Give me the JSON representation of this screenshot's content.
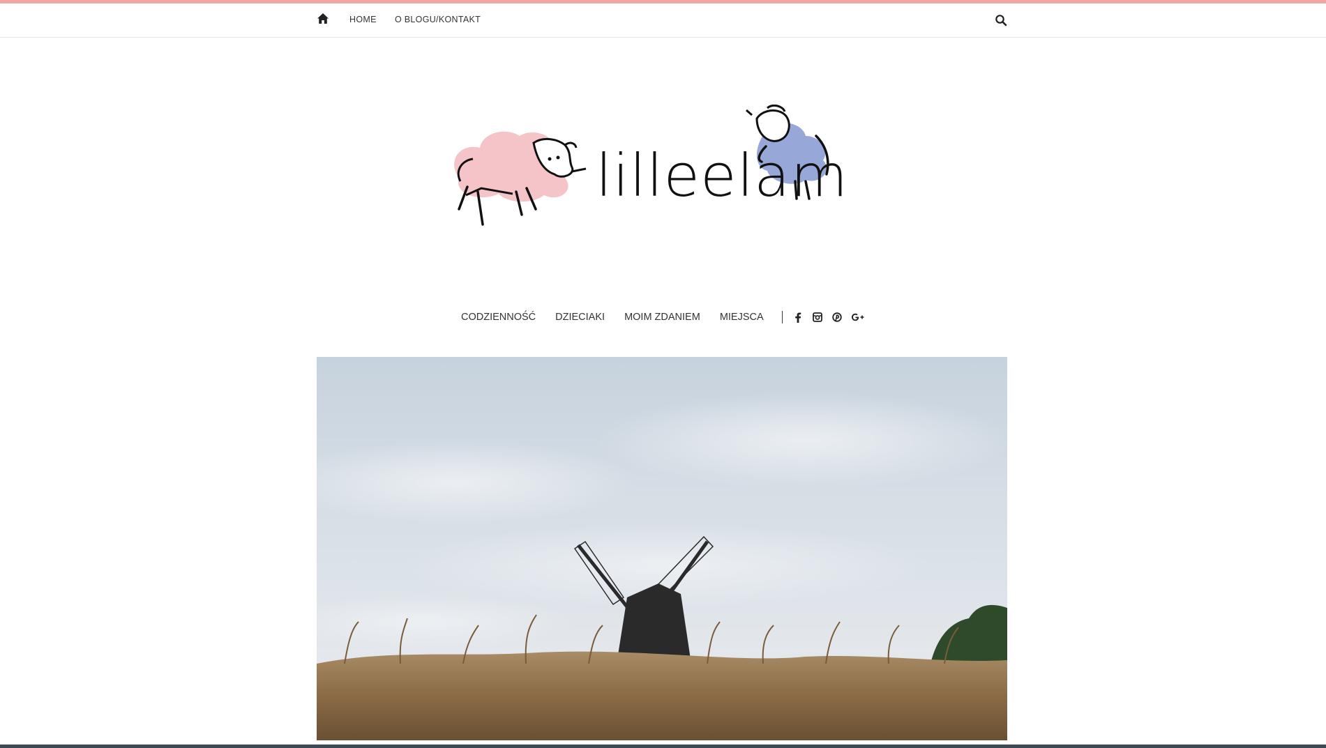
{
  "colors": {
    "accent": "#f2a7a0",
    "sheep_pink": "#f5c4c8",
    "sheep_blue": "#97a8d8"
  },
  "topnav": {
    "home_icon": "home-icon",
    "links": [
      "HOME",
      "O BLOGU/KONTAKT"
    ],
    "search_icon": "search-icon"
  },
  "logo": {
    "text": "lilleelam"
  },
  "category_nav": {
    "items": [
      "CODZIENNOŚĆ",
      "DZIECIAKI",
      "MOIM ZDANIEM",
      "MIEJSCA"
    ],
    "social_icons": [
      "facebook-icon",
      "instagram-icon",
      "pinterest-icon",
      "google-plus-icon"
    ]
  },
  "hero": {
    "image": "windmill in wheat field"
  }
}
